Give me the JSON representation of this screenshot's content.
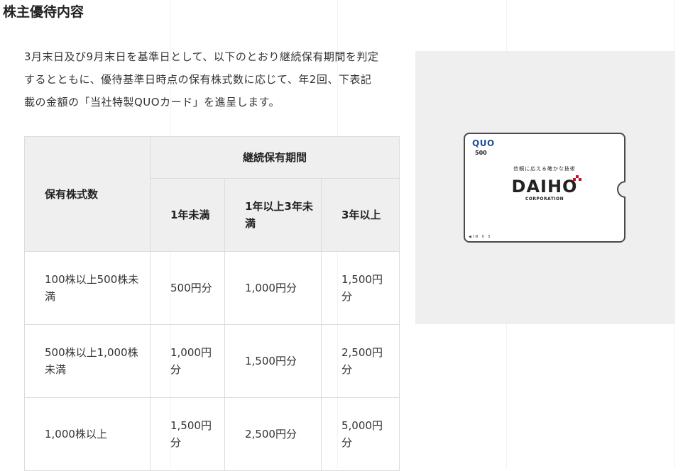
{
  "section": {
    "title": "株主優待内容",
    "intro": "3月末日及び9月末日を基準日として、以下のとおり継続保有期間を判定するとともに、優待基準日時点の保有株式数に応じて、年2回、下表記載の金額の「当社特製QUOカード」を進呈します。"
  },
  "table": {
    "header_shares": "保有株式数",
    "header_period": "継続保有期間",
    "periods": [
      "1年未満",
      "1年以上3年未満",
      "3年以上"
    ],
    "rows": [
      {
        "shares": "100株以上500株未満",
        "values": [
          "500円分",
          "1,000円分",
          "1,500円分"
        ]
      },
      {
        "shares": "500株以上1,000株未満",
        "values": [
          "1,000円分",
          "1,500円分",
          "2,500円分"
        ]
      },
      {
        "shares": "1,000株以上",
        "values": [
          "1,500円分",
          "2,500円分",
          "5,000円分"
        ]
      }
    ]
  },
  "card": {
    "logo": "QUO",
    "value": "500",
    "slogan": "信頼に応える確かな技術",
    "brand": "DAIHO",
    "brand_sub": "CORPORATION",
    "code": "IN 0 5",
    "colors": {
      "logo": "#1f4d9a",
      "accent": "#c8102e"
    }
  }
}
